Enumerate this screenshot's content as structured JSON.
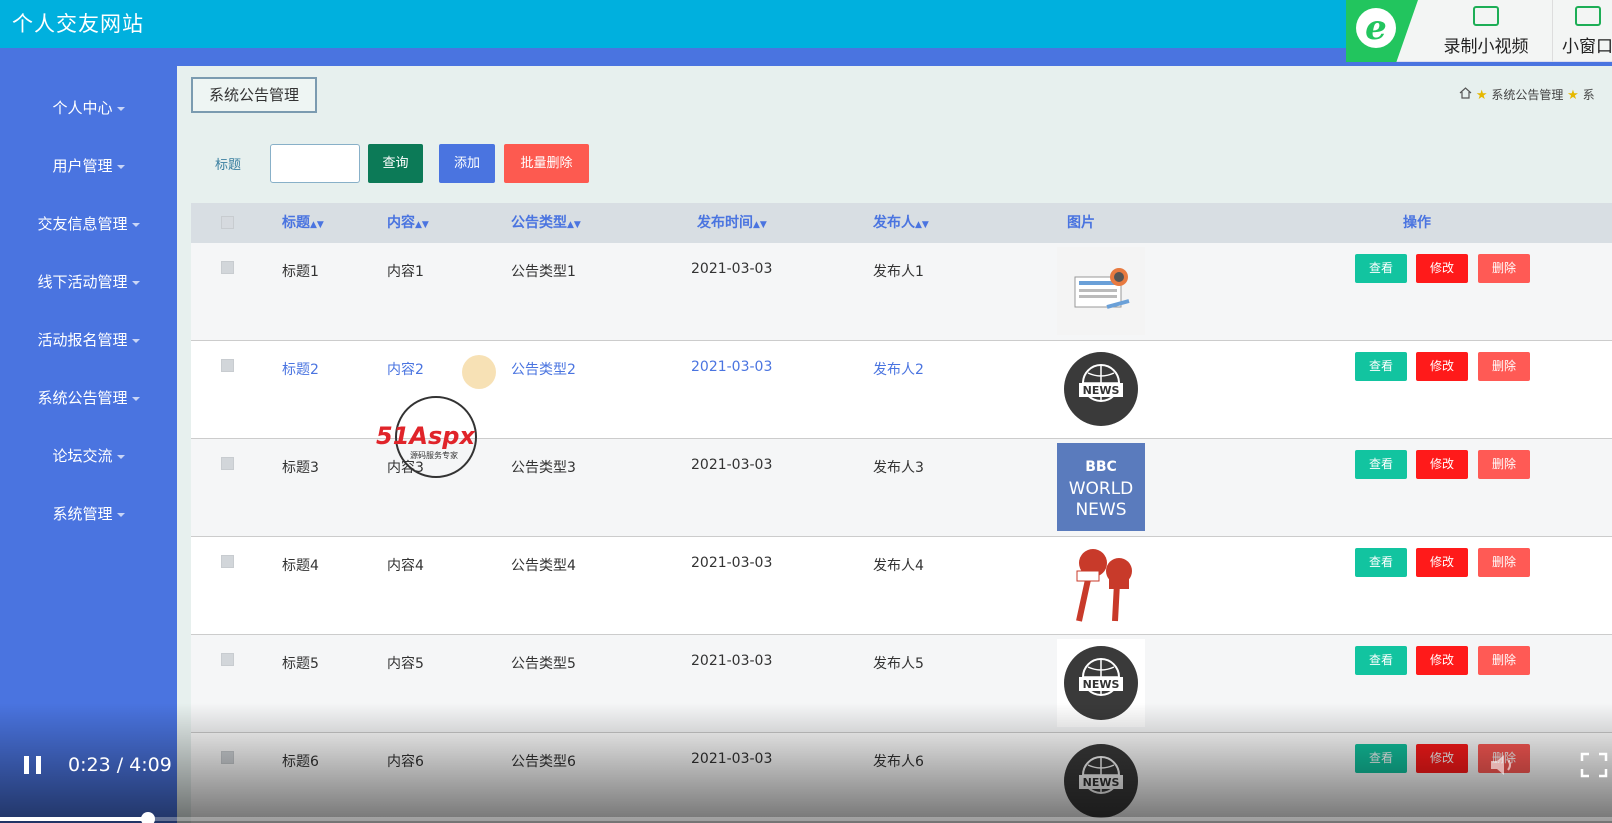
{
  "header": {
    "title": "个人交友网站"
  },
  "recorder": {
    "logo_letter": "e",
    "record_label": "录制小视频",
    "window_label": "小窗口"
  },
  "sidebar": {
    "items": [
      {
        "label": "个人中心"
      },
      {
        "label": "用户管理"
      },
      {
        "label": "交友信息管理"
      },
      {
        "label": "线下活动管理"
      },
      {
        "label": "活动报名管理"
      },
      {
        "label": "系统公告管理"
      },
      {
        "label": "论坛交流"
      },
      {
        "label": "系统管理"
      }
    ]
  },
  "content": {
    "tag": "系统公告管理",
    "breadcrumb": {
      "item1": "系统公告管理",
      "item2": "系"
    },
    "search": {
      "label": "标题",
      "value": "",
      "placeholder": ""
    },
    "buttons": {
      "query": "查询",
      "add": "添加",
      "batch_delete": "批量删除"
    }
  },
  "table": {
    "columns": {
      "title": "标题",
      "content": "内容",
      "type": "公告类型",
      "time": "发布时间",
      "publisher": "发布人",
      "image": "图片",
      "actions": "操作"
    },
    "action_labels": {
      "view": "查看",
      "edit": "修改",
      "delete": "删除"
    },
    "rows": [
      {
        "title": "标题1",
        "content": "内容1",
        "type": "公告类型1",
        "time": "2021-03-03",
        "publisher": "发布人1",
        "image": "news-paper-icon"
      },
      {
        "title": "标题2",
        "content": "内容2",
        "type": "公告类型2",
        "time": "2021-03-03",
        "publisher": "发布人2",
        "image": "news-globe-icon"
      },
      {
        "title": "标题3",
        "content": "内容3",
        "type": "公告类型3",
        "time": "2021-03-03",
        "publisher": "发布人3",
        "image": "bbc-world-news-icon"
      },
      {
        "title": "标题4",
        "content": "内容4",
        "type": "公告类型4",
        "time": "2021-03-03",
        "publisher": "发布人4",
        "image": "news-microphone-icon"
      },
      {
        "title": "标题5",
        "content": "内容5",
        "type": "公告类型5",
        "time": "2021-03-03",
        "publisher": "发布人5",
        "image": "news-globe-icon"
      },
      {
        "title": "标题6",
        "content": "内容6",
        "type": "公告类型6",
        "time": "2021-03-03",
        "publisher": "发布人6",
        "image": "news-globe-icon"
      }
    ]
  },
  "bbc_logo": {
    "line1": "BBC",
    "line2": "WORLD",
    "line3": "NEWS"
  },
  "news_badge": "NEWS",
  "watermark": {
    "brand": "51Aspx",
    "tagline": "源码服务专家"
  },
  "player": {
    "time": "0:23 / 4:09",
    "progress": 0.092
  },
  "colors": {
    "header": "#00b0de",
    "sidebar": "#4a74e0",
    "query": "#0c7a57",
    "add": "#4a74e0",
    "batch_delete": "#fd5a50",
    "view": "#12c4a0",
    "edit": "#ff1a1a",
    "delete": "#ff5a55"
  }
}
